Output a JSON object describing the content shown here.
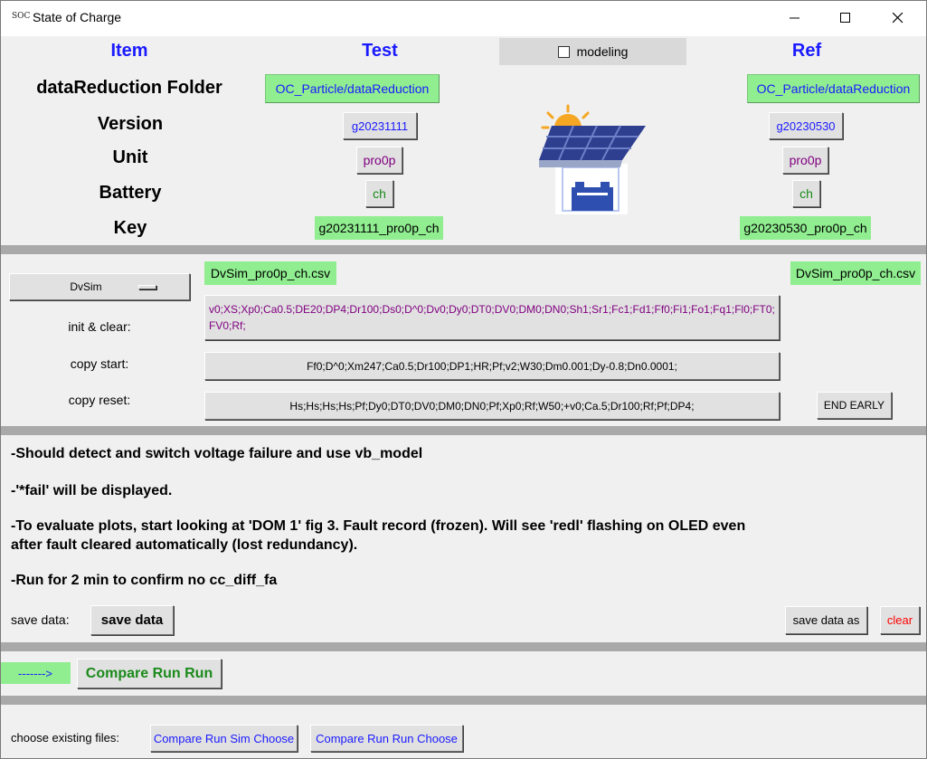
{
  "window": {
    "app_icon": "SOC",
    "title": "State of Charge"
  },
  "header": {
    "item": "Item",
    "test": "Test",
    "ref": "Ref",
    "modeling_label": "modeling",
    "modeling_checked": false
  },
  "rows": {
    "folder_label": "dataReduction Folder",
    "version_label": "Version",
    "unit_label": "Unit",
    "battery_label": "Battery",
    "key_label": "Key"
  },
  "test": {
    "folder": "OC_Particle/dataReduction",
    "version": "g20231111",
    "unit": "pro0p",
    "battery": "ch",
    "key": "g20231111_pro0p_ch"
  },
  "ref": {
    "folder": "OC_Particle/dataReduction",
    "version": "g20230530",
    "unit": "pro0p",
    "battery": "ch",
    "key": "g20230530_pro0p_ch"
  },
  "sim": {
    "selector": "DvSim",
    "test_file": "DvSim_pro0p_ch.csv",
    "ref_file": "DvSim_pro0p_ch.csv",
    "init_label": "init & clear:",
    "init_cmd": "v0;XS;Xp0;Ca0.5;DE20;DP4;Dr100;Ds0;D^0;Dv0;Dy0;DT0;DV0;DM0;DN0;Sh1;Sr1;Fc1;Fd1;Ff0;Fi1;Fo1;Fq1;Fl0;FT0;FV0;Rf;",
    "copy_start_label": "copy start:",
    "copy_start_cmd": "Ff0;D^0;Xm247;Ca0.5;Dr100;DP1;HR;Pf;v2;W30;Dm0.001;Dy-0.8;Dn0.0001;",
    "copy_reset_label": "copy reset:",
    "copy_reset_cmd": "Hs;Hs;Hs;Hs;Pf;Dy0;DT0;DV0;DM0;DN0;Pf;Xp0;Rf;W50;+v0;Ca.5;Dr100;Rf;Pf;DP4;",
    "end_early": "END EARLY"
  },
  "notes": {
    "line1": "-Should detect and switch voltage failure and use vb_model",
    "line2": "-'*fail' will be displayed.",
    "line3a": "-To evaluate plots, start looking at 'DOM 1' fig 3. Fault record (frozen). Will see 'redl' flashing on OLED even",
    "line3b": "after fault cleared automatically (lost redundancy).",
    "line4": "-Run for 2 min to confirm no cc_diff_fa"
  },
  "save": {
    "label": "save data:",
    "save_button": "save data",
    "save_as_button": "save data as",
    "clear_button": "clear"
  },
  "compare": {
    "arrow": "------->",
    "button": "Compare Run Run"
  },
  "choose": {
    "label": "choose existing files:",
    "sim_button": "Compare Run Sim Choose",
    "run_button": "Compare Run Run Choose"
  },
  "colors": {
    "accent_blue": "#1a1aff",
    "green_bg": "#90ee90",
    "purple_text": "#800080",
    "clear_red": "#ff0000",
    "separator": "#a9a9a9"
  },
  "icons": [
    "soc-app-icon",
    "minimize-icon",
    "maximize-icon",
    "close-icon",
    "solar-panel-icon",
    "dropdown-indicator-icon"
  ]
}
